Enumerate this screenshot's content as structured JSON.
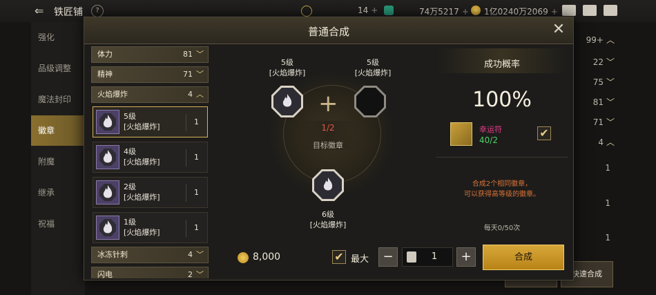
{
  "topbar": {
    "title": "铁匠铺",
    "help": "?",
    "res1": "14",
    "res2": "74万5217",
    "res3": "1亿0240万2069",
    "plus": "+"
  },
  "nav": {
    "items": [
      "强化",
      "品级调整",
      "魔法封印",
      "徽章",
      "附魔",
      "继承",
      "祝福"
    ]
  },
  "bg_list": {
    "counts": [
      "99+",
      "22",
      "75",
      "81",
      "71",
      "4"
    ],
    "qty": [
      "1",
      "1",
      "1"
    ],
    "quick_button": "快速合成"
  },
  "modal": {
    "title": "普通合成",
    "close": "✕"
  },
  "list": {
    "categories": [
      {
        "label": "体力",
        "count": "81"
      },
      {
        "label": "精神",
        "count": "71"
      },
      {
        "label": "火焰爆炸",
        "count": "4"
      },
      {
        "label": "冰冻针刺",
        "count": "4"
      },
      {
        "label": "闪电",
        "count": "2"
      }
    ],
    "cards": [
      {
        "level": "5级",
        "name": "[火焰爆炸]",
        "qty": "1"
      },
      {
        "level": "4级",
        "name": "[火焰爆炸]",
        "qty": "1"
      },
      {
        "level": "2级",
        "name": "[火焰爆炸]",
        "qty": "1"
      },
      {
        "level": "1级",
        "name": "[火焰爆炸]",
        "qty": "1"
      }
    ]
  },
  "synth": {
    "left_level": "5级",
    "left_name": "[火焰爆炸]",
    "right_level": "5级",
    "right_name": "[火焰爆炸]",
    "ratio": "1/2",
    "target_label": "目标徽章",
    "result_level": "6级",
    "result_name": "[火焰爆炸]"
  },
  "right": {
    "title": "成功概率",
    "rate": "100%",
    "charm_name": "幸运符",
    "charm_count": "40/2",
    "desc_line1": "合成2个相同徽章，",
    "desc_line2": "可以获得高等级的徽章。",
    "daily": "每天0/50次"
  },
  "bottom": {
    "cost": "8,000",
    "max_label": "最大",
    "minus": "−",
    "plus": "+",
    "qty": "1",
    "button": "合成"
  },
  "colors": {
    "accent_gold": "#d6b25b",
    "ratio_red": "#e0584a",
    "charm_pink": "#e23c8b",
    "charm_green": "#52d16a",
    "desc_orange": "#d8733a"
  }
}
